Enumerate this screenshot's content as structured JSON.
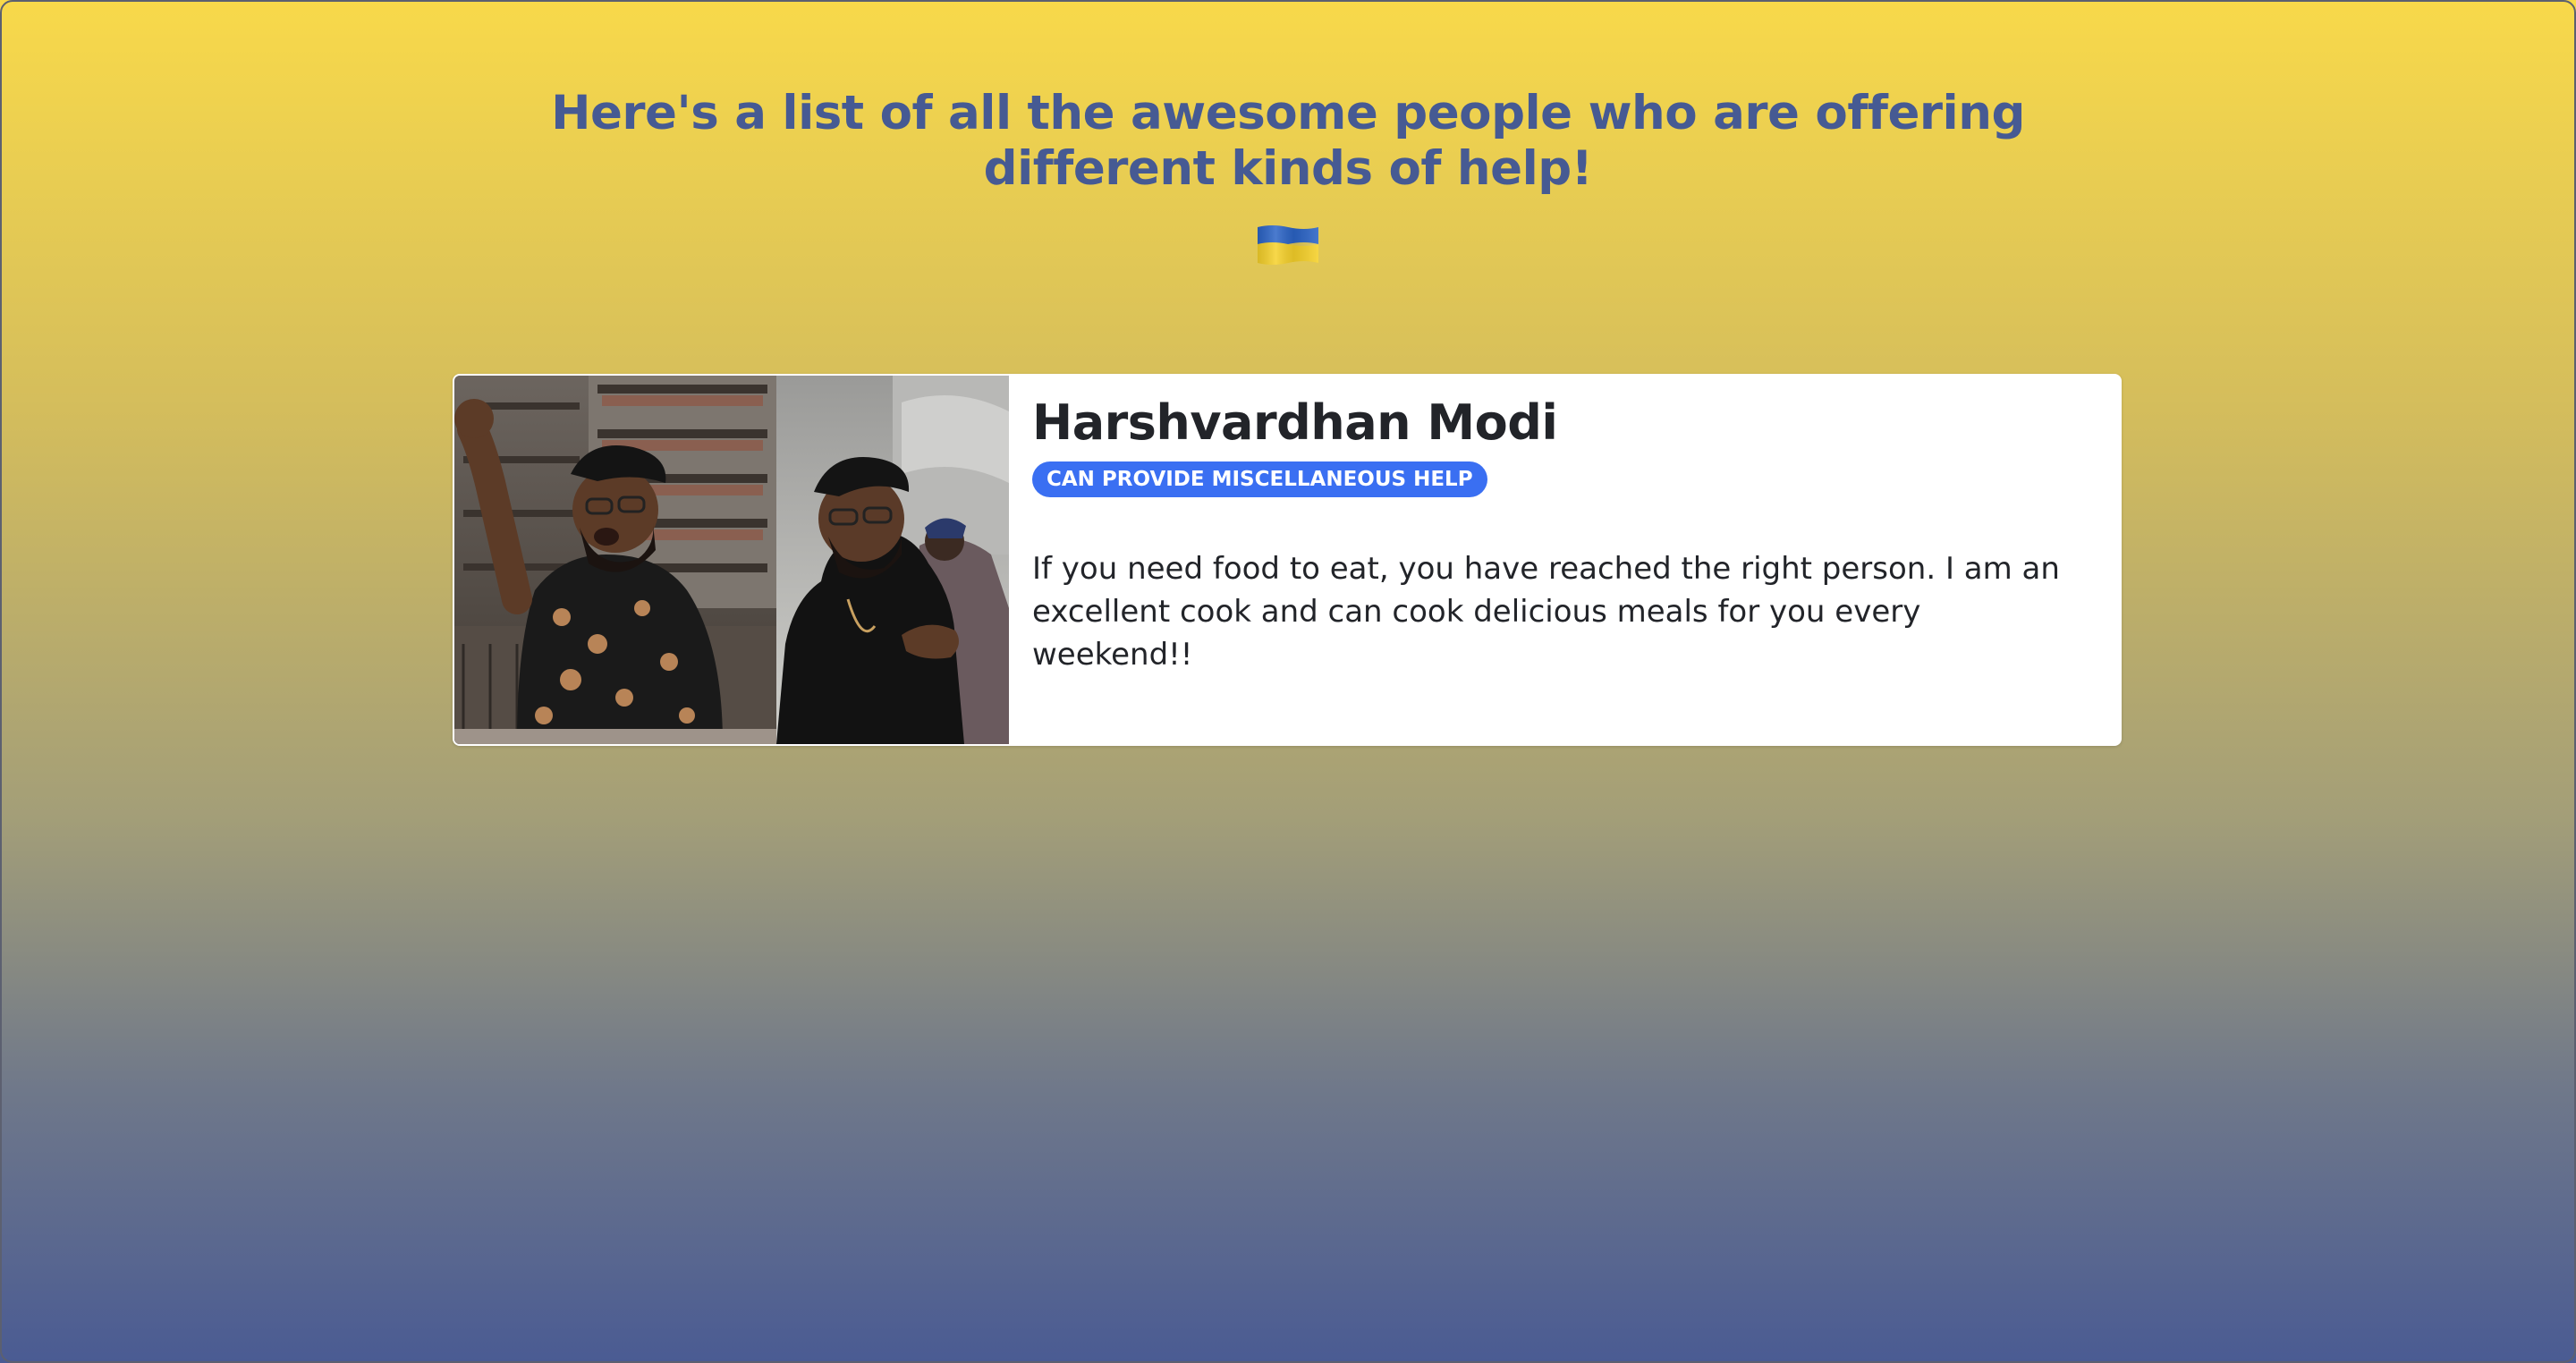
{
  "page": {
    "headline": "Here's a list of all the awesome people who are offering different kinds of help!",
    "flag_icon": "ukraine-flag-icon"
  },
  "colors": {
    "headline": "#465a93",
    "badge_bg": "#3a6ff2",
    "gradient_top": "#f8d94a",
    "gradient_bottom": "#4a5b93"
  },
  "helpers": [
    {
      "name": "Harshvardhan Modi",
      "category": "CAN PROVIDE MISCELLANEOUS HELP",
      "description": "If you need food to eat, you have reached the right person. I am an excellent cook and can cook delicious meals for you every weekend!!",
      "photo": "photo-two-men-protesting"
    }
  ]
}
